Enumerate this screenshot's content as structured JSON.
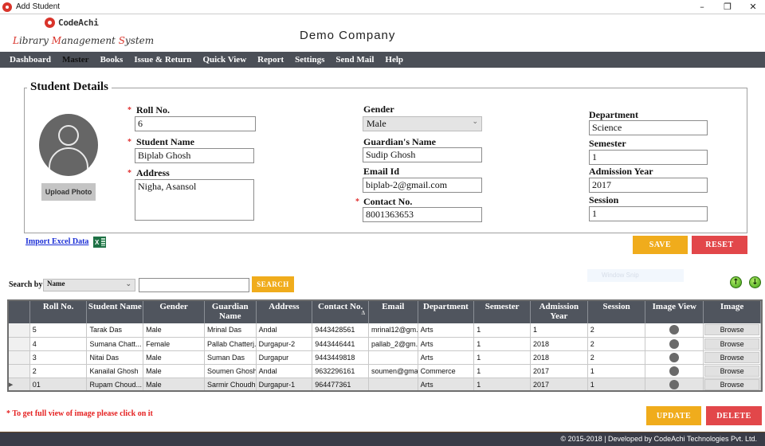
{
  "window": {
    "title": "Add Student",
    "controls": {
      "minimize": "–",
      "restore": "❐",
      "close": "✕"
    }
  },
  "header": {
    "logo_text": "CodeAchi",
    "subtitle_parts": [
      "L",
      "ibrary ",
      "M",
      "anagement ",
      "S",
      "ystem"
    ],
    "company": "Demo Company"
  },
  "menu": {
    "items": [
      {
        "label": "Dashboard"
      },
      {
        "label": "Master",
        "active": true
      },
      {
        "label": "Books"
      },
      {
        "label": "Issue & Return"
      },
      {
        "label": "Quick View"
      },
      {
        "label": "Report"
      },
      {
        "label": "Settings"
      },
      {
        "label": "Send Mail"
      },
      {
        "label": "Help"
      }
    ]
  },
  "form": {
    "section_title": "Student Details",
    "upload_photo": "Upload Photo",
    "required_mark": "*",
    "roll_no": {
      "label": "Roll No.",
      "value": "6"
    },
    "student_name": {
      "label": "Student Name",
      "value": "Biplab Ghosh"
    },
    "address": {
      "label": "Address",
      "value": "Nigha, Asansol"
    },
    "gender": {
      "label": "Gender",
      "value": "Male"
    },
    "guardian_name": {
      "label": "Guardian's Name",
      "value": "Sudip Ghosh"
    },
    "email": {
      "label": "Email Id",
      "value": "biplab-2@gmail.com"
    },
    "contact": {
      "label": "Contact No.",
      "value": "8001363653"
    },
    "department": {
      "label": "Department",
      "value": "Science"
    },
    "semester": {
      "label": "Semester",
      "value": "1"
    },
    "admission_year": {
      "label": "Admission Year",
      "value": "2017"
    },
    "session": {
      "label": "Session",
      "value": "1"
    },
    "save": "SAVE",
    "reset": "RESET"
  },
  "import": {
    "label": "Import Excel Data",
    "icon_text": "X"
  },
  "search": {
    "label": "Search by",
    "field_value": "Name",
    "query": "",
    "button": "SEARCH"
  },
  "overlay": {
    "window_snip": "Window Snip"
  },
  "table": {
    "columns": [
      "Roll No.",
      "Student Name",
      "Gender",
      "Guardian Name",
      "Address",
      "Contact No.",
      "Email",
      "Department",
      "Semester",
      "Admission Year",
      "Session",
      "Image View",
      "Image"
    ],
    "sort_indicator": "Δ",
    "browse_label": "Browse",
    "rows": [
      {
        "roll": "5",
        "name": "Tarak Das",
        "gender": "Male",
        "guardian": "Mrinal Das",
        "address": "Andal",
        "contact": "9443428561",
        "email": "mrinal12@gm...",
        "dept": "Arts",
        "semester": "1",
        "year": "1",
        "session": "2"
      },
      {
        "roll": "4",
        "name": "Sumana Chatt...",
        "gender": "Female",
        "guardian": "Pallab Chatterj...",
        "address": "Durgapur-2",
        "contact": "9443446441",
        "email": "pallab_2@gm...",
        "dept": "Arts",
        "semester": "1",
        "year": "2018",
        "session": "2"
      },
      {
        "roll": "3",
        "name": "Nitai Das",
        "gender": "Male",
        "guardian": "Suman Das",
        "address": "Durgapur",
        "contact": "9443449818",
        "email": "",
        "dept": "Arts",
        "semester": "1",
        "year": "2018",
        "session": "2"
      },
      {
        "roll": "2",
        "name": "Kanailal Ghosh",
        "gender": "Male",
        "guardian": "Soumen Ghosh",
        "address": "Andal",
        "contact": "9632296161",
        "email": "soumen@gma...",
        "dept": "Commerce",
        "semester": "1",
        "year": "2017",
        "session": "1"
      },
      {
        "roll": "01",
        "name": "Rupam Choud...",
        "gender": "Male",
        "guardian": "Sarmir Choudh...",
        "address": "Durgapur-1",
        "contact": "964477361",
        "email": "",
        "dept": "Arts",
        "semester": "1",
        "year": "2017",
        "session": "1",
        "selected": true
      }
    ]
  },
  "note": "* To get full view of image please click on it",
  "actions": {
    "update": "UPDATE",
    "delete": "DELETE"
  },
  "footer": {
    "copyright": "© 2015-2018 | Developed by CodeAchi Technologies Pvt. Ltd."
  }
}
